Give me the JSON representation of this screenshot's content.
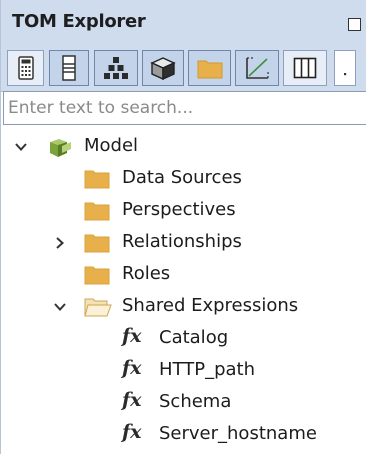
{
  "panel": {
    "title": "TOM Explorer"
  },
  "toolbar": {
    "buttons": [
      {
        "icon": "calculator-icon"
      },
      {
        "icon": "column-list-icon"
      },
      {
        "icon": "hierarchy-icon"
      },
      {
        "icon": "cube-icon"
      },
      {
        "icon": "folder-icon"
      },
      {
        "icon": "measure-chart-icon"
      },
      {
        "icon": "columns-icon"
      },
      {
        "icon": "more-icon"
      }
    ]
  },
  "search": {
    "placeholder": "Enter text to search...",
    "value": ""
  },
  "tree": {
    "root": {
      "label": "Model",
      "expanded": true
    },
    "items": [
      {
        "label": "Data Sources",
        "icon": "folder-icon"
      },
      {
        "label": "Perspectives",
        "icon": "folder-icon"
      },
      {
        "label": "Relationships",
        "icon": "folder-icon",
        "expandable": true
      },
      {
        "label": "Roles",
        "icon": "folder-icon"
      },
      {
        "label": "Shared Expressions",
        "icon": "open-folder-icon",
        "expanded": true
      }
    ],
    "expressions": [
      {
        "label": "Catalog",
        "glyph": "fx"
      },
      {
        "label": "HTTP_path",
        "glyph": "fx"
      },
      {
        "label": "Schema",
        "glyph": "fx"
      },
      {
        "label": "Server_hostname",
        "glyph": "fx"
      }
    ]
  },
  "colors": {
    "header_bg": "#cfdcee",
    "folder": "#e8b04a",
    "model_icon": "#7aa33a"
  }
}
